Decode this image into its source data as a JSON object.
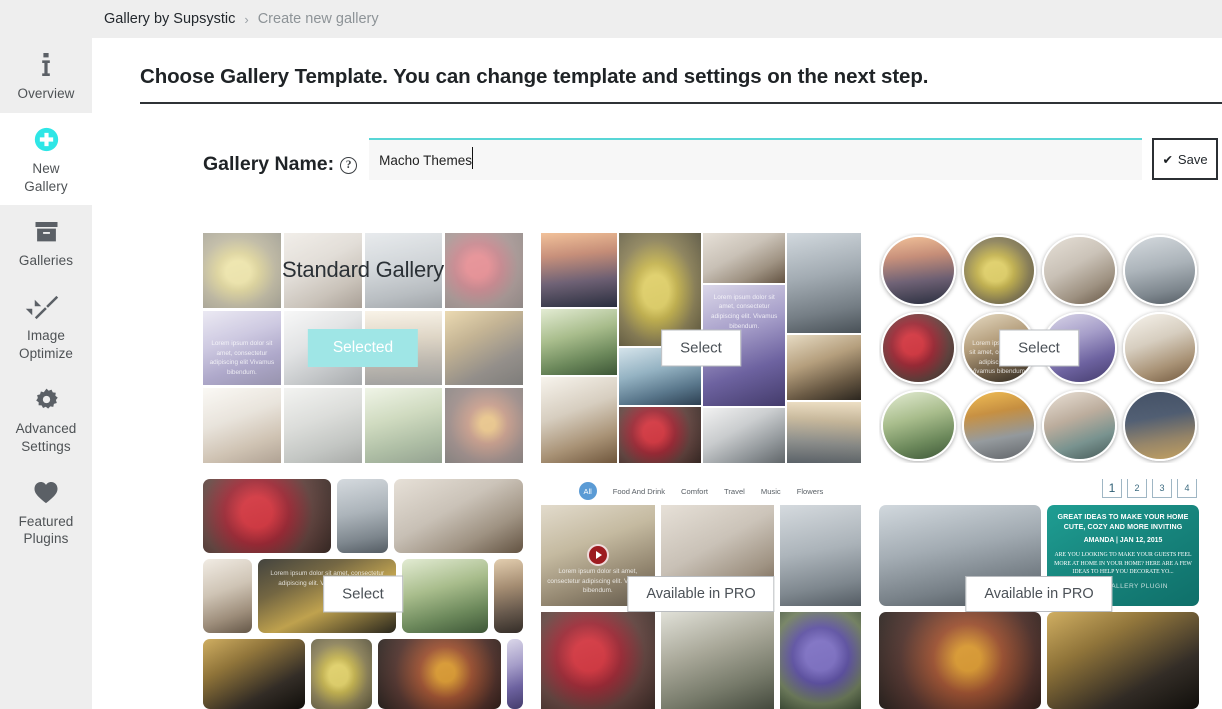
{
  "breadcrumb": {
    "root": "Gallery by Supsystic",
    "separator": "›",
    "current": "Create new gallery"
  },
  "sidebar": {
    "items": [
      {
        "label": "Overview",
        "icon": "info-icon",
        "active": false
      },
      {
        "label": "New\nGallery",
        "icon": "plus-circle-icon",
        "active": true
      },
      {
        "label": "Galleries",
        "icon": "archive-box-icon",
        "active": false
      },
      {
        "label": "Image\nOptimize",
        "icon": "compress-arrows-icon",
        "active": false
      },
      {
        "label": "Advanced\nSettings",
        "icon": "gear-icon",
        "active": false
      },
      {
        "label": "Featured\nPlugins",
        "icon": "heart-icon",
        "active": false
      }
    ],
    "labels": {
      "overview": "Overview",
      "new_gallery_line1": "New",
      "new_gallery_line2": "Gallery",
      "galleries": "Galleries",
      "image_optimize_line1": "Image",
      "image_optimize_line2": "Optimize",
      "advanced_line1": "Advanced",
      "advanced_line2": "Settings",
      "featured_line1": "Featured",
      "featured_line2": "Plugins"
    }
  },
  "main": {
    "page_title": "Choose Gallery Template. You can change template and settings on the next step.",
    "gallery_name_label": "Gallery Name:",
    "help_glyph": "?",
    "gallery_name_value": "Macho Themes",
    "gallery_name_placeholder": "Gallery Name",
    "save_label": "Save",
    "save_check_glyph": "✔"
  },
  "templates": [
    {
      "id": "standard-gallery",
      "title": "Standard Gallery",
      "action_label": "Selected",
      "state": "selected",
      "layout": "grid"
    },
    {
      "id": "mosaic-gallery",
      "title": "",
      "action_label": "Select",
      "state": "available",
      "layout": "mosaic",
      "caption": "Lorem ipsum dolor sit amet, consectetur adipiscing elit. Vivamus bibendum."
    },
    {
      "id": "circle-gallery",
      "title": "",
      "action_label": "Select",
      "state": "available",
      "layout": "circles",
      "caption": "Lorem ipsum dolor sit amet, consectetur adipiscing elit. Vivamus bibendum."
    },
    {
      "id": "justified-gallery",
      "title": "",
      "action_label": "Select",
      "state": "available",
      "layout": "justified",
      "caption": "Lorem ipsum dolor sit amet, consectetur adipiscing elit. Vivamus bibendum."
    },
    {
      "id": "filter-gallery-pro",
      "title": "",
      "action_label": "Available in PRO",
      "state": "pro",
      "layout": "filtered",
      "caption": "Lorem ipsum dolor sit amet, consectetur adipiscing elit. Vivamus bibendum.",
      "filters": [
        "All",
        "Food And Drink",
        "Comfort",
        "Travel",
        "Music",
        "Flowers"
      ]
    },
    {
      "id": "paged-gallery-pro",
      "title": "",
      "action_label": "Available in PRO",
      "state": "pro",
      "layout": "paged",
      "pagination": [
        "1",
        "2",
        "3",
        "4"
      ],
      "promo_card": {
        "headline": "GREAT IDEAS TO MAKE YOUR HOME CUTE, COZY AND MORE INVITING",
        "byline": "AMANDA | JAN 12, 2015",
        "body": "ARE YOU LOOKING TO MAKE YOUR GUESTS FEEL MORE AT HOME IN YOUR HOME? HERE ARE A FEW IDEAS TO HELP YOU DECORATE YO...",
        "footer": "PHOTO GALLERY PLUGIN"
      }
    }
  ],
  "colors": {
    "accent_cyan": "#2ee6e6",
    "selected_badge": "#9fe6e6",
    "sidebar_bg": "#eeeeee",
    "input_top_border": "#58d6d6",
    "filter_active": "#5b9bd5",
    "promo_teal": "#17857d"
  }
}
